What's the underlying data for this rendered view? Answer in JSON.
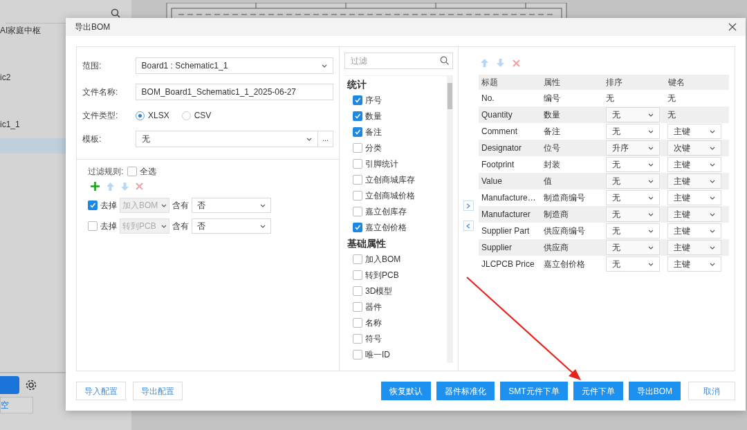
{
  "background": {
    "sidebar_items": [
      "AI家庭中枢",
      "ic2",
      "ic1_1"
    ],
    "bottom_link": "空"
  },
  "dialog": {
    "title": "导出BOM",
    "form": {
      "scope": {
        "label": "范围:",
        "value": "Board1 : Schematic1_1"
      },
      "file_name": {
        "label": "文件名称:",
        "value": "BOM_Board1_Schematic1_1_2025-06-27"
      },
      "file_type": {
        "label": "文件类型:",
        "options": [
          {
            "label": "XLSX",
            "selected": true
          },
          {
            "label": "CSV",
            "selected": false
          }
        ]
      },
      "template": {
        "label": "模板:",
        "value": "无",
        "more": "..."
      }
    },
    "filter_rules": {
      "label": "过滤规则:",
      "select_all": {
        "label": "全选",
        "checked": false
      },
      "rules": [
        {
          "checked": true,
          "action": "去掉",
          "field": "加入BOM",
          "op": "含有",
          "value": "否"
        },
        {
          "checked": false,
          "action": "去掉",
          "field": "转到PCB",
          "op": "含有",
          "value": "否"
        }
      ]
    },
    "field_filter": {
      "placeholder": "过滤"
    },
    "groups": [
      {
        "title": "统计",
        "items": [
          {
            "label": "序号",
            "checked": true
          },
          {
            "label": "数量",
            "checked": true
          },
          {
            "label": "备注",
            "checked": true
          },
          {
            "label": "分类",
            "checked": false
          },
          {
            "label": "引脚统计",
            "checked": false
          },
          {
            "label": "立创商城库存",
            "checked": false
          },
          {
            "label": "立创商城价格",
            "checked": false
          },
          {
            "label": "嘉立创库存",
            "checked": false
          },
          {
            "label": "嘉立创价格",
            "checked": true
          }
        ]
      },
      {
        "title": "基础属性",
        "items": [
          {
            "label": "加入BOM",
            "checked": false
          },
          {
            "label": "转到PCB",
            "checked": false
          },
          {
            "label": "3D模型",
            "checked": false
          },
          {
            "label": "器件",
            "checked": false
          },
          {
            "label": "名称",
            "checked": false
          },
          {
            "label": "符号",
            "checked": false
          },
          {
            "label": "唯一ID",
            "checked": false
          }
        ]
      }
    ],
    "table": {
      "columns": [
        "标题",
        "属性",
        "排序",
        "键名"
      ],
      "rows": [
        {
          "title": "No.",
          "property": "编号",
          "sort": {
            "kind": "text",
            "value": "无"
          },
          "key": {
            "kind": "text",
            "value": "无"
          }
        },
        {
          "title": "Quantity",
          "property": "数量",
          "sort": {
            "kind": "select",
            "value": "无"
          },
          "key": {
            "kind": "text",
            "value": "无"
          }
        },
        {
          "title": "Comment",
          "property": "备注",
          "sort": {
            "kind": "select",
            "value": "无"
          },
          "key": {
            "kind": "select",
            "value": "主键"
          }
        },
        {
          "title": "Designator",
          "property": "位号",
          "sort": {
            "kind": "select",
            "value": "升序"
          },
          "key": {
            "kind": "select",
            "value": "次键"
          }
        },
        {
          "title": "Footprint",
          "property": "封装",
          "sort": {
            "kind": "select",
            "value": "无"
          },
          "key": {
            "kind": "select",
            "value": "主键"
          }
        },
        {
          "title": "Value",
          "property": "值",
          "sort": {
            "kind": "select",
            "value": "无"
          },
          "key": {
            "kind": "select",
            "value": "主键"
          }
        },
        {
          "title": "Manufacture…",
          "property": "制造商编号",
          "sort": {
            "kind": "select",
            "value": "无"
          },
          "key": {
            "kind": "select",
            "value": "主键"
          }
        },
        {
          "title": "Manufacturer",
          "property": "制造商",
          "sort": {
            "kind": "select",
            "value": "无"
          },
          "key": {
            "kind": "select",
            "value": "主键"
          }
        },
        {
          "title": "Supplier Part",
          "property": "供应商编号",
          "sort": {
            "kind": "select",
            "value": "无"
          },
          "key": {
            "kind": "select",
            "value": "主键"
          }
        },
        {
          "title": "Supplier",
          "property": "供应商",
          "sort": {
            "kind": "select",
            "value": "无"
          },
          "key": {
            "kind": "select",
            "value": "主键"
          }
        },
        {
          "title": "JLCPCB Price",
          "property": "嘉立创价格",
          "sort": {
            "kind": "select",
            "value": "无"
          },
          "key": {
            "kind": "select",
            "value": "主键"
          }
        }
      ]
    },
    "footer_left": [
      "导入配置",
      "导出配置"
    ],
    "footer_right": [
      {
        "label": "恢复默认",
        "kind": "primary"
      },
      {
        "label": "器件标准化",
        "kind": "primary"
      },
      {
        "label": "SMT元件下单",
        "kind": "primary"
      },
      {
        "label": "元件下单",
        "kind": "primary"
      },
      {
        "label": "导出BOM",
        "kind": "primary"
      },
      {
        "label": "取消",
        "kind": "default"
      }
    ]
  }
}
